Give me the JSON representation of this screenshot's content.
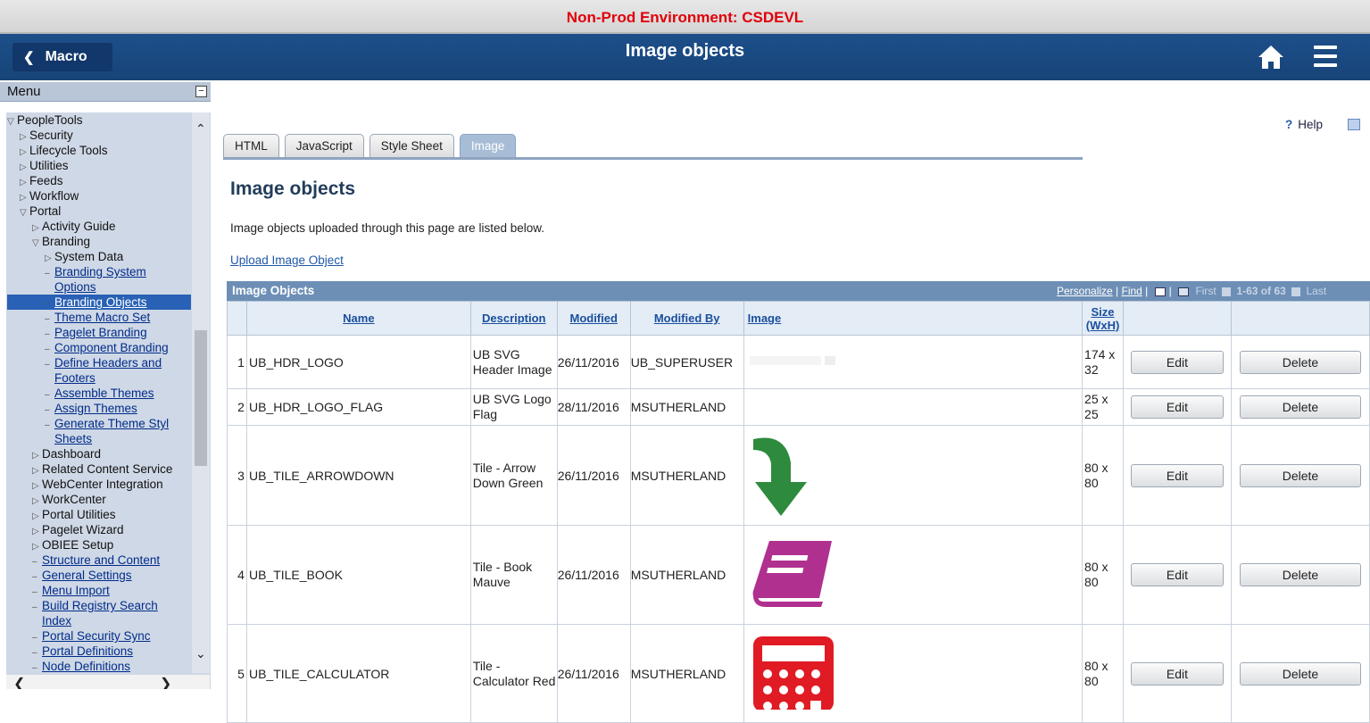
{
  "banner": {
    "environment": "Non-Prod Environment: CSDEVL"
  },
  "header": {
    "back_label": "Macro",
    "title": "Image objects"
  },
  "sidebar": {
    "title": "Menu",
    "tree": [
      {
        "label": "PeopleTools",
        "indent": 0,
        "marker": "open",
        "link": false
      },
      {
        "label": "Security",
        "indent": 1,
        "marker": "closed",
        "link": false
      },
      {
        "label": "Lifecycle Tools",
        "indent": 1,
        "marker": "closed",
        "link": false
      },
      {
        "label": "Utilities",
        "indent": 1,
        "marker": "closed",
        "link": false
      },
      {
        "label": "Feeds",
        "indent": 1,
        "marker": "closed",
        "link": false
      },
      {
        "label": "Workflow",
        "indent": 1,
        "marker": "closed",
        "link": false
      },
      {
        "label": "Portal",
        "indent": 1,
        "marker": "open",
        "link": false
      },
      {
        "label": "Activity Guide",
        "indent": 2,
        "marker": "closed",
        "link": false
      },
      {
        "label": "Branding",
        "indent": 2,
        "marker": "open",
        "link": false
      },
      {
        "label": "System Data",
        "indent": 3,
        "marker": "closed",
        "link": false
      },
      {
        "label": "Branding System",
        "indent": 3,
        "marker": "dash",
        "link": true
      },
      {
        "label": "Options",
        "indent": 3,
        "marker": "none",
        "link": true
      },
      {
        "label": "Branding Objects",
        "indent": 3,
        "marker": "dash",
        "link": true,
        "selected": true
      },
      {
        "label": "Theme Macro Set",
        "indent": 3,
        "marker": "dash",
        "link": true
      },
      {
        "label": "Pagelet Branding",
        "indent": 3,
        "marker": "dash",
        "link": true
      },
      {
        "label": "Component Branding",
        "indent": 3,
        "marker": "dash",
        "link": true
      },
      {
        "label": "Define Headers and",
        "indent": 3,
        "marker": "dash",
        "link": true
      },
      {
        "label": "Footers",
        "indent": 3,
        "marker": "none",
        "link": true
      },
      {
        "label": "Assemble Themes",
        "indent": 3,
        "marker": "dash",
        "link": true
      },
      {
        "label": "Assign Themes",
        "indent": 3,
        "marker": "dash",
        "link": true
      },
      {
        "label": "Generate Theme Styl",
        "indent": 3,
        "marker": "dash",
        "link": true
      },
      {
        "label": "Sheets",
        "indent": 3,
        "marker": "none",
        "link": true
      },
      {
        "label": "Dashboard",
        "indent": 2,
        "marker": "closed",
        "link": false
      },
      {
        "label": "Related Content Service",
        "indent": 2,
        "marker": "closed",
        "link": false
      },
      {
        "label": "WebCenter Integration",
        "indent": 2,
        "marker": "closed",
        "link": false
      },
      {
        "label": "WorkCenter",
        "indent": 2,
        "marker": "closed",
        "link": false
      },
      {
        "label": "Portal Utilities",
        "indent": 2,
        "marker": "closed",
        "link": false
      },
      {
        "label": "Pagelet Wizard",
        "indent": 2,
        "marker": "closed",
        "link": false
      },
      {
        "label": "OBIEE Setup",
        "indent": 2,
        "marker": "closed",
        "link": false
      },
      {
        "label": "Structure and Content",
        "indent": 2,
        "marker": "dash",
        "link": true
      },
      {
        "label": "General Settings",
        "indent": 2,
        "marker": "dash",
        "link": true
      },
      {
        "label": "Menu Import",
        "indent": 2,
        "marker": "dash",
        "link": true
      },
      {
        "label": "Build Registry Search",
        "indent": 2,
        "marker": "dash",
        "link": true
      },
      {
        "label": "Index",
        "indent": 2,
        "marker": "none",
        "link": true
      },
      {
        "label": "Portal Security Sync",
        "indent": 2,
        "marker": "dash",
        "link": true
      },
      {
        "label": "Portal Definitions",
        "indent": 2,
        "marker": "dash",
        "link": true
      },
      {
        "label": "Node Definitions",
        "indent": 2,
        "marker": "dash",
        "link": true
      }
    ]
  },
  "toolbar": {
    "help_label": "Help"
  },
  "tabs": [
    {
      "label": "HTML",
      "active": false
    },
    {
      "label": "JavaScript",
      "active": false
    },
    {
      "label": "Style Sheet",
      "active": false
    },
    {
      "label": "Image",
      "active": true
    }
  ],
  "page": {
    "title": "Image objects",
    "description": "Image objects uploaded through this page are listed below.",
    "upload_link": "Upload Image Object"
  },
  "grid": {
    "title": "Image Objects",
    "personalize": "Personalize",
    "find": "Find",
    "first": "First",
    "range": "1-63 of 63",
    "last": "Last",
    "columns": {
      "name": "Name",
      "description": "Description",
      "modified": "Modified",
      "modified_by": "Modified By",
      "image": "Image",
      "size": "Size (WxH)"
    },
    "rows": [
      {
        "num": "1",
        "name": "UB_HDR_LOGO",
        "description": "UB SVG Header Image",
        "modified": "26/11/2016",
        "modified_by": "UB_SUPERUSER",
        "size": "174 x 32",
        "image": "logo",
        "edit": "Edit",
        "delete": "Delete"
      },
      {
        "num": "2",
        "name": "UB_HDR_LOGO_FLAG",
        "description": "UB SVG Logo Flag",
        "modified": "28/11/2016",
        "modified_by": "MSUTHERLAND",
        "size": "25 x 25",
        "image": "none",
        "edit": "Edit",
        "delete": "Delete"
      },
      {
        "num": "3",
        "name": "UB_TILE_ARROWDOWN",
        "description": "Tile - Arrow Down Green",
        "modified": "26/11/2016",
        "modified_by": "MSUTHERLAND",
        "size": "80 x 80",
        "image": "arrow-down-icon",
        "edit": "Edit",
        "delete": "Delete"
      },
      {
        "num": "4",
        "name": "UB_TILE_BOOK",
        "description": "Tile - Book Mauve",
        "modified": "26/11/2016",
        "modified_by": "MSUTHERLAND",
        "size": "80 x 80",
        "image": "book-icon",
        "edit": "Edit",
        "delete": "Delete"
      },
      {
        "num": "5",
        "name": "UB_TILE_CALCULATOR",
        "description": "Tile - Calculator Red",
        "modified": "26/11/2016",
        "modified_by": "MSUTHERLAND",
        "size": "80 x 80",
        "image": "calculator-icon",
        "edit": "Edit",
        "delete": "Delete"
      }
    ]
  },
  "colors": {
    "banner_text": "#e0000a",
    "header_bg": "#1d4f8a",
    "arrow_green": "#2e8b3e",
    "book_mauve": "#b0308f",
    "calculator_red": "#e01b24"
  }
}
